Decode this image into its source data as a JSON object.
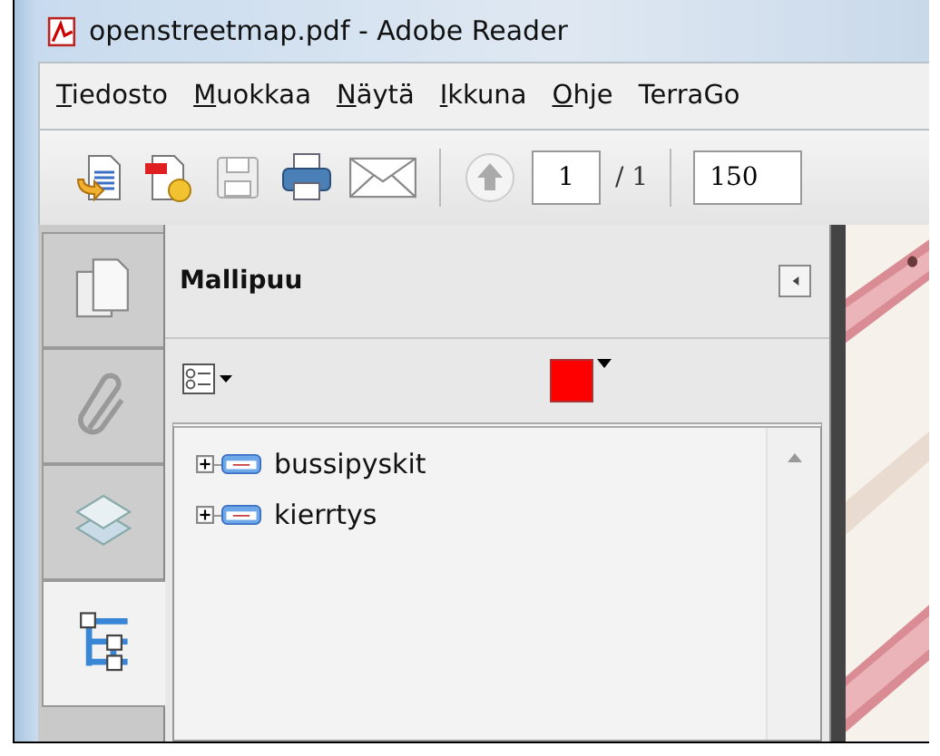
{
  "window": {
    "title": "openstreetmap.pdf - Adobe Reader"
  },
  "menu": [
    {
      "label": "Tiedosto",
      "first_letter_underlined": true
    },
    {
      "label": "Muokkaa",
      "first_letter_underlined": true
    },
    {
      "label": "Näytä",
      "first_letter_underlined": true
    },
    {
      "label": "Ikkuna",
      "first_letter_underlined": true
    },
    {
      "label": "Ohje",
      "first_letter_underlined": true
    },
    {
      "label": "TerraGo",
      "first_letter_underlined": false
    }
  ],
  "toolbar": {
    "page_number": "1",
    "page_count": "/ 1",
    "zoom": "150"
  },
  "nav_tabs": [
    {
      "kind": "pages",
      "selected": false
    },
    {
      "kind": "attachments",
      "selected": false
    },
    {
      "kind": "layers",
      "selected": false
    },
    {
      "kind": "model_tree",
      "selected": true
    }
  ],
  "panel": {
    "title": "Mallipuu",
    "highlight": {
      "color": "#ff0000"
    },
    "tree": [
      {
        "label": "bussipyskit",
        "expanded": false
      },
      {
        "label": "kierrtys",
        "expanded": false
      }
    ]
  }
}
